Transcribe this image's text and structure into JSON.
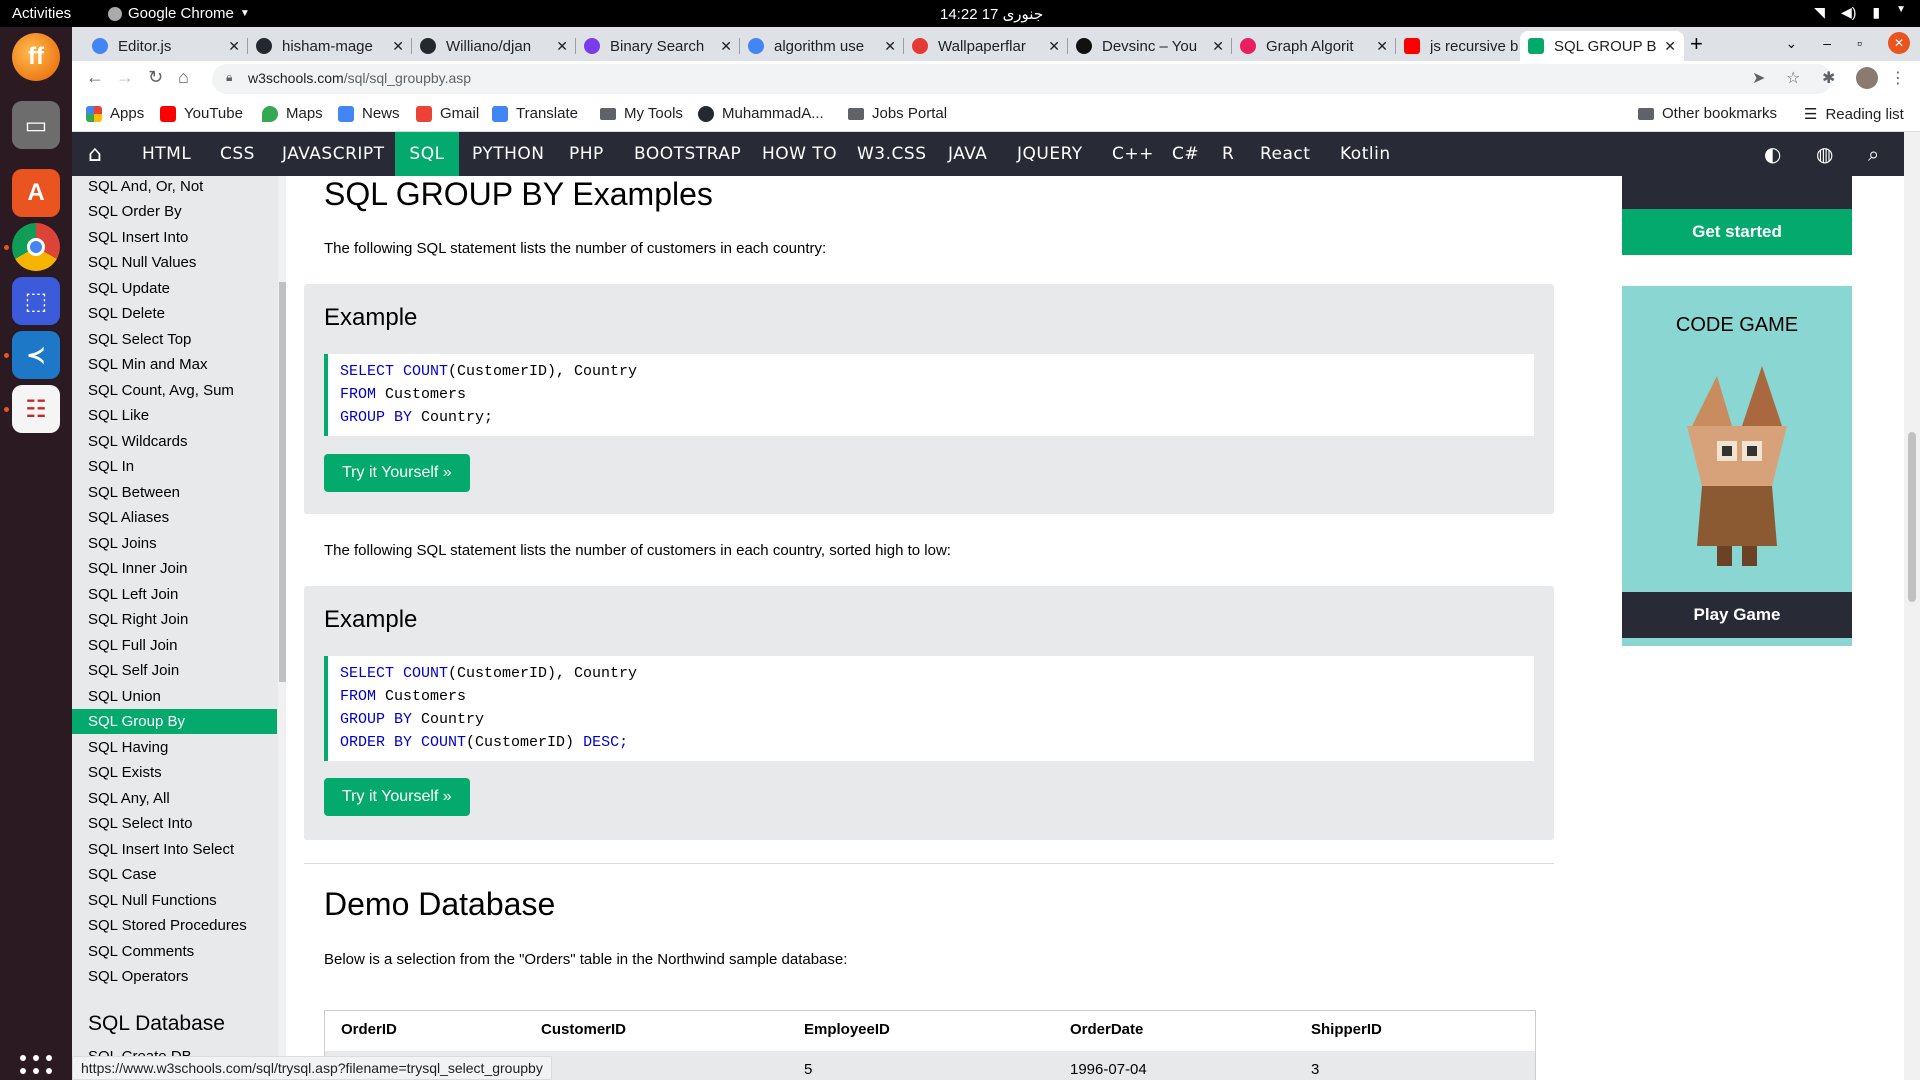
{
  "os": {
    "activities": "Activities",
    "app_name": "Google Chrome",
    "clock": "14:22  17 جنوری"
  },
  "tabs": [
    {
      "label": "Editor.js",
      "color": "#4285f4"
    },
    {
      "label": "hisham-mage",
      "color": "#24292f"
    },
    {
      "label": "Williano/djan",
      "color": "#24292f"
    },
    {
      "label": "Binary Search",
      "color": "#7c3aed"
    },
    {
      "label": "algorithm use",
      "color": "#4285f4"
    },
    {
      "label": "Wallpaperflar",
      "color": "#e53935"
    },
    {
      "label": "Devsinc – You",
      "color": "#111111"
    },
    {
      "label": "Graph Algorit",
      "color": "#e91e63"
    },
    {
      "label": "js recursive b",
      "color": "#ff0000"
    },
    {
      "label": "SQL GROUP B",
      "color": "#04aa6d"
    }
  ],
  "address": {
    "host": "w3schools.com",
    "path": "/sql/sql_groupby.asp"
  },
  "bookmarks": [
    {
      "label": "Apps",
      "color": "#ea4335"
    },
    {
      "label": "YouTube",
      "color": "#ff0000"
    },
    {
      "label": "Maps",
      "color": "#34a853"
    },
    {
      "label": "News",
      "color": "#4285f4"
    },
    {
      "label": "Gmail",
      "color": "#ea4335"
    },
    {
      "label": "Translate",
      "color": "#4285f4"
    },
    {
      "label": "My Tools",
      "color": "#5f6368"
    },
    {
      "label": "MuhammadA...",
      "color": "#24292f"
    },
    {
      "label": "Jobs Portal",
      "color": "#5f6368"
    }
  ],
  "bookmarks_right": {
    "other": "Other bookmarks",
    "reading": "Reading list"
  },
  "w3nav": [
    "HTML",
    "CSS",
    "JAVASCRIPT",
    "SQL",
    "PYTHON",
    "PHP",
    "BOOTSTRAP",
    "HOW TO",
    "W3.CSS",
    "JAVA",
    "JQUERY",
    "C++",
    "C#",
    "R",
    "React",
    "Kotlin"
  ],
  "sidebar": {
    "items": [
      "SQL And, Or, Not",
      "SQL Order By",
      "SQL Insert Into",
      "SQL Null Values",
      "SQL Update",
      "SQL Delete",
      "SQL Select Top",
      "SQL Min and Max",
      "SQL Count, Avg, Sum",
      "SQL Like",
      "SQL Wildcards",
      "SQL In",
      "SQL Between",
      "SQL Aliases",
      "SQL Joins",
      "SQL Inner Join",
      "SQL Left Join",
      "SQL Right Join",
      "SQL Full Join",
      "SQL Self Join",
      "SQL Union",
      "SQL Group By",
      "SQL Having",
      "SQL Exists",
      "SQL Any, All",
      "SQL Select Into",
      "SQL Insert Into Select",
      "SQL Case",
      "SQL Null Functions",
      "SQL Stored Procedures",
      "SQL Comments",
      "SQL Operators"
    ],
    "active": "SQL Group By",
    "heading": "SQL Database",
    "next_item": "SQL Create DB"
  },
  "main": {
    "title": "SQL GROUP BY Examples",
    "intro1": "The following SQL statement lists the number of customers in each country:",
    "example_label": "Example",
    "example1": [
      {
        "kw": "SELECT ",
        "fn": "COUNT",
        "rest": "(CustomerID), Country"
      },
      {
        "kw": "FROM ",
        "fn": "",
        "rest": "Customers"
      },
      {
        "kw": "GROUP BY ",
        "fn": "",
        "rest": "Country;"
      }
    ],
    "try_label": "Try it Yourself »",
    "intro2": "The following SQL statement lists the number of customers in each country, sorted high to low:",
    "example2": [
      {
        "kw": "SELECT ",
        "fn": "COUNT",
        "rest": "(CustomerID), Country"
      },
      {
        "kw": "FROM ",
        "fn": "",
        "rest": "Customers"
      },
      {
        "kw": "GROUP BY ",
        "fn": "",
        "rest": "Country"
      },
      {
        "kw": "ORDER BY ",
        "fn": "COUNT",
        "rest": "(CustomerID) ",
        "tail": "DESC;"
      }
    ],
    "demo_title": "Demo Database",
    "demo_text": "Below is a selection from the \"Orders\" table in the Northwind sample database:",
    "table": {
      "headers": [
        "OrderID",
        "CustomerID",
        "EmployeeID",
        "OrderDate",
        "ShipperID"
      ],
      "rows": [
        [
          "",
          "",
          "5",
          "1996-07-04",
          "3"
        ]
      ]
    }
  },
  "ads": {
    "get_started": "Get started",
    "code_game": "CODE GAME",
    "play_game": "Play Game"
  },
  "status_url": "https://www.w3schools.com/sql/trysql.asp?filename=trysql_select_groupby"
}
